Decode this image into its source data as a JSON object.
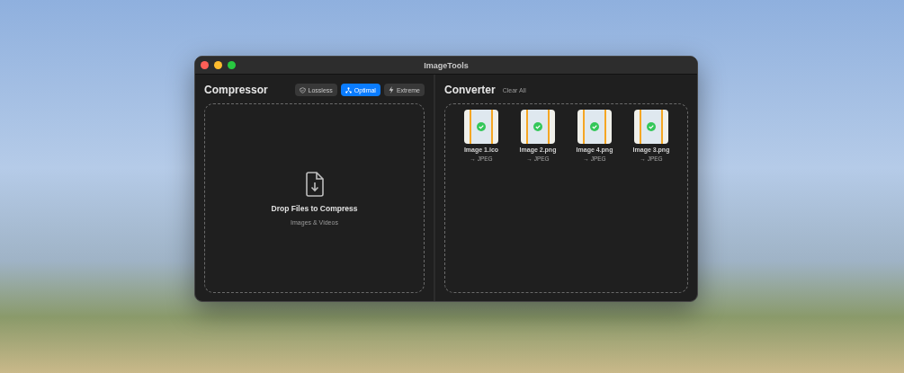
{
  "window": {
    "title": "ImageTools"
  },
  "compressor": {
    "title": "Compressor",
    "modes": [
      {
        "label": "Lossless",
        "kind": "shield",
        "selected": false
      },
      {
        "label": "Optimal",
        "kind": "nodes",
        "selected": true
      },
      {
        "label": "Extreme",
        "kind": "bolt",
        "selected": false
      }
    ],
    "drop_title": "Drop Files to Compress",
    "drop_subtitle": "Images & Videos"
  },
  "converter": {
    "title": "Converter",
    "clear": "Clear All",
    "files": [
      {
        "name": "Image 1.ico",
        "target": "→ JPEG"
      },
      {
        "name": "Image 2.png",
        "target": "→ JPEG"
      },
      {
        "name": "Image 4.png",
        "target": "→ JPEG"
      },
      {
        "name": "Image 3.png",
        "target": "→ JPEG"
      }
    ]
  }
}
